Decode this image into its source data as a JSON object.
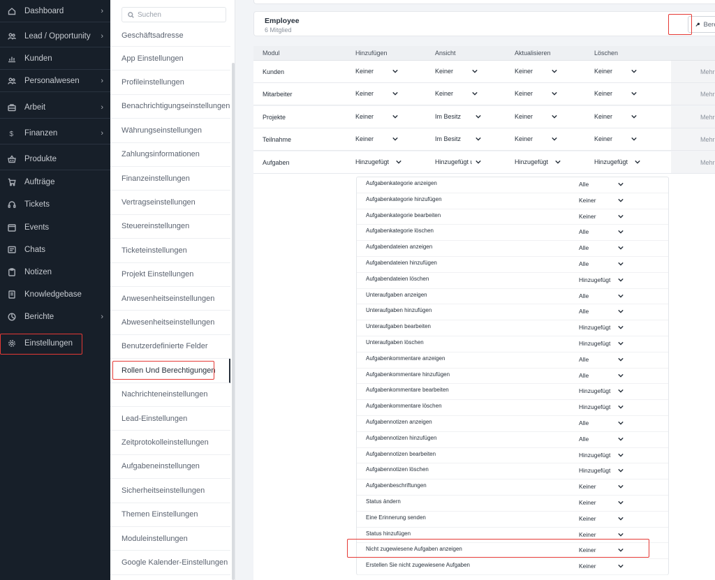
{
  "sidebar": {
    "items": [
      {
        "label": "Dashboard",
        "icon": "home-icon",
        "chevron": true
      },
      {
        "label": "Lead / Opportunity",
        "icon": "users-icon",
        "chevron": true
      },
      {
        "label": "Kunden",
        "icon": "chart-icon",
        "chevron": false
      },
      {
        "label": "Personalwesen",
        "icon": "users-icon",
        "chevron": true
      },
      {
        "label": "Arbeit",
        "icon": "briefcase-icon",
        "chevron": true
      },
      {
        "label": "Finanzen",
        "icon": "dollar-icon",
        "chevron": true
      },
      {
        "label": "Produkte",
        "icon": "basket-icon",
        "chevron": false
      },
      {
        "label": "Aufträge",
        "icon": "cart-icon",
        "chevron": false
      },
      {
        "label": "Tickets",
        "icon": "headset-icon",
        "chevron": false
      },
      {
        "label": "Events",
        "icon": "calendar-icon",
        "chevron": false
      },
      {
        "label": "Chats",
        "icon": "chat-icon",
        "chevron": false
      },
      {
        "label": "Notizen",
        "icon": "clipboard-icon",
        "chevron": false
      },
      {
        "label": "Knowledgebase",
        "icon": "book-icon",
        "chevron": false
      },
      {
        "label": "Berichte",
        "icon": "pie-chart-icon",
        "chevron": true
      },
      {
        "label": "Einstellungen",
        "icon": "gear-icon",
        "chevron": false
      }
    ],
    "chevron_glyph": "›"
  },
  "settings_menu": {
    "search_placeholder": "Suchen",
    "items": [
      "Geschäftsadresse",
      "App Einstellungen",
      "Profileinstellungen",
      "Benachrichtigungseinstellungen",
      "Währungseinstellungen",
      "Zahlungsinformationen",
      "Finanzeinstellungen",
      "Vertragseinstellungen",
      "Steuereinstellungen",
      "Ticketeinstellungen",
      "Projekt Einstellungen",
      "Anwesenheitseinstellungen",
      "Abwesenheitseinstellungen",
      "Benutzerdefinierte Felder",
      "Rollen Und Berechtigungen",
      "Nachrichteneinstellungen",
      "Lead-Einstellungen",
      "Zeitprotokolleinstellungen",
      "Aufgabeneinstellungen",
      "Sicherheitseinstellungen",
      "Themen Einstellungen",
      "Moduleinstellungen",
      "Google Kalender-Einstellungen"
    ],
    "active_index": 14
  },
  "role": {
    "title": "Employee",
    "members": "6 Mitglied",
    "permission_button": "Berechtigungen"
  },
  "table": {
    "headers": [
      "Modul",
      "Hinzufügen",
      "Ansicht",
      "Aktualisieren",
      "Löschen"
    ],
    "rows": [
      {
        "module": "Kunden",
        "add": "Keiner",
        "view": "Keiner",
        "update": "Keiner",
        "delete": "Keiner",
        "more": "Mehr"
      },
      {
        "module": "Mitarbeiter",
        "add": "Keiner",
        "view": "Keiner",
        "update": "Keiner",
        "delete": "Keiner",
        "more": "Mehr"
      },
      {
        "module": "Projekte",
        "add": "Keiner",
        "view": "Im Besitz",
        "update": "Keiner",
        "delete": "Keiner",
        "more": "Mehr"
      },
      {
        "module": "Teilnahme",
        "add": "Keiner",
        "view": "Im Besitz",
        "update": "Keiner",
        "delete": "Keiner",
        "more": "Mehr"
      },
      {
        "module": "Aufgaben",
        "add": "Hinzugefügt",
        "view": "Hinzugefügt u",
        "update": "Hinzugefügt",
        "delete": "Hinzugefügt",
        "more": "Mehr"
      }
    ]
  },
  "task_permissions": [
    {
      "label": "Aufgabenkategorie anzeigen",
      "value": "Alle"
    },
    {
      "label": "Aufgabenkategorie hinzufügen",
      "value": "Keiner"
    },
    {
      "label": "Aufgabenkategorie bearbeiten",
      "value": "Keiner"
    },
    {
      "label": "Aufgabenkategorie löschen",
      "value": "Alle"
    },
    {
      "label": "Aufgabendateien anzeigen",
      "value": "Alle"
    },
    {
      "label": "Aufgabendateien hinzufügen",
      "value": "Alle"
    },
    {
      "label": "Aufgabendateien löschen",
      "value": "Hinzugefügt"
    },
    {
      "label": "Unteraufgaben anzeigen",
      "value": "Alle"
    },
    {
      "label": "Unteraufgaben hinzufügen",
      "value": "Alle"
    },
    {
      "label": "Unteraufgaben bearbeiten",
      "value": "Hinzugefügt"
    },
    {
      "label": "Unteraufgaben löschen",
      "value": "Hinzugefügt"
    },
    {
      "label": "Aufgabenkommentare anzeigen",
      "value": "Alle"
    },
    {
      "label": "Aufgabenkommentare hinzufügen",
      "value": "Alle"
    },
    {
      "label": "Aufgabenkommentare bearbeiten",
      "value": "Hinzugefügt"
    },
    {
      "label": "Aufgabenkommentare löschen",
      "value": "Hinzugefügt"
    },
    {
      "label": "Aufgabennotizen anzeigen",
      "value": "Alle"
    },
    {
      "label": "Aufgabennotizen hinzufügen",
      "value": "Alle"
    },
    {
      "label": "Aufgabennotizen bearbeiten",
      "value": "Hinzugefügt"
    },
    {
      "label": "Aufgabennotizen löschen",
      "value": "Hinzugefügt"
    },
    {
      "label": "Aufgabenbeschriftungen",
      "value": "Keiner"
    },
    {
      "label": "Status ändern",
      "value": "Keiner"
    },
    {
      "label": "Eine Erinnerung senden",
      "value": "Keiner"
    },
    {
      "label": "Status hinzufügen",
      "value": "Keiner"
    },
    {
      "label": "Nicht zugewiesene Aufgaben anzeigen",
      "value": "Keiner"
    },
    {
      "label": "Erstellen Sie nicht zugewiesene Aufgaben",
      "value": "Keiner"
    }
  ],
  "colors": {
    "sidebar_bg": "#171f29",
    "highlight": "#e53935",
    "text": "#28313c"
  }
}
